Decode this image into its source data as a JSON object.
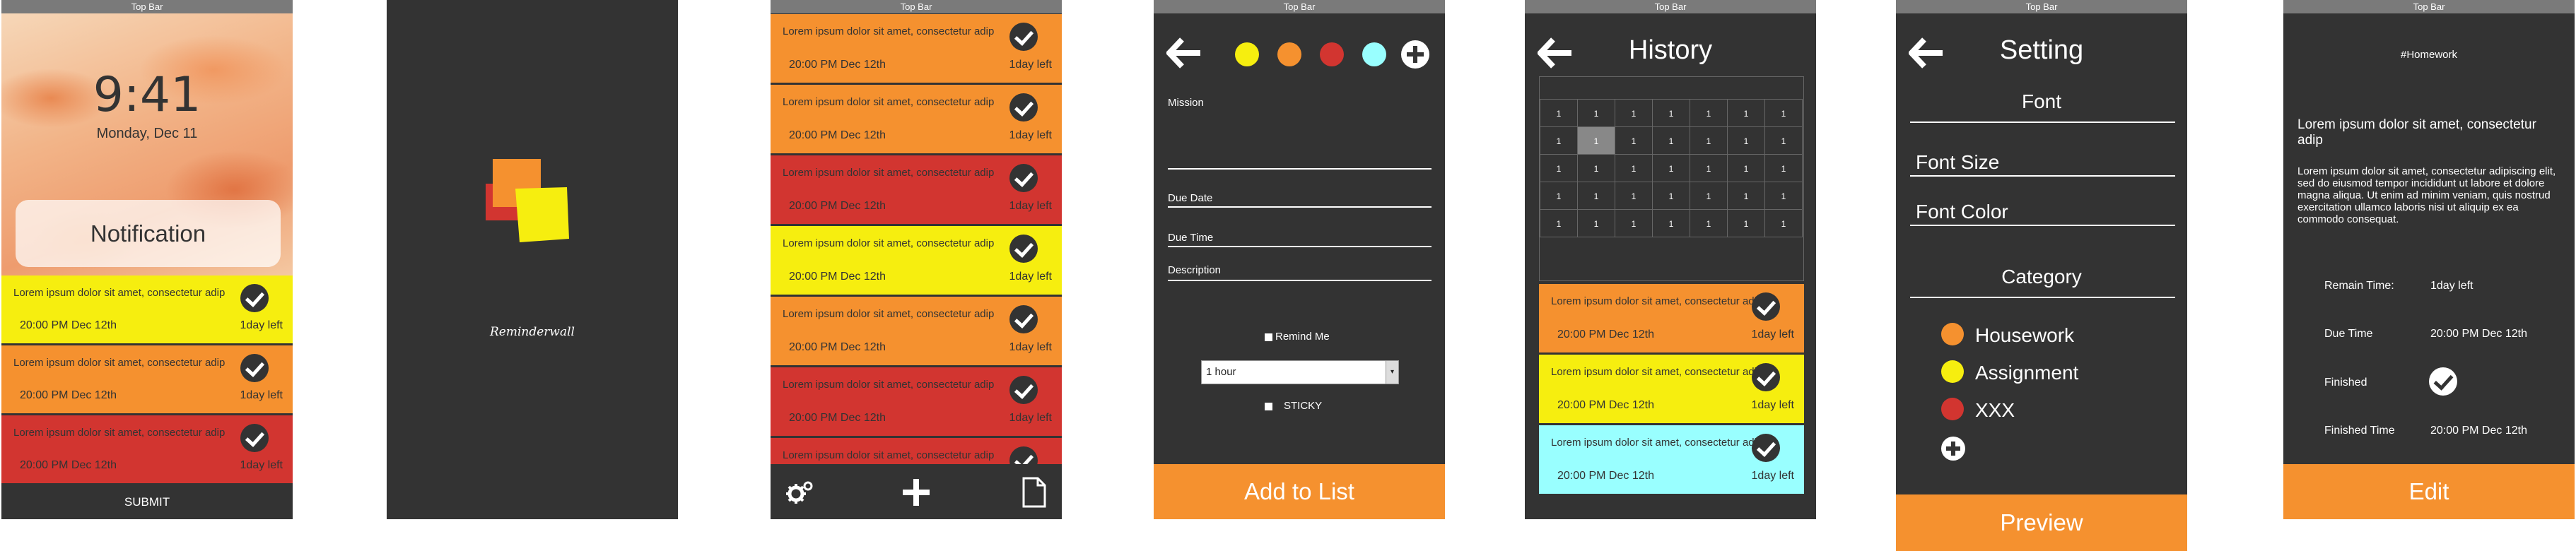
{
  "top_bar_label": "Top Bar",
  "colors": {
    "yellow": "#f6ee0f",
    "orange": "#f5912f",
    "red": "#d23530",
    "cyan": "#99ffff",
    "dark": "#333333"
  },
  "lock_screen": {
    "time": "9:41",
    "date": "Monday, Dec 11",
    "notification_label": "Notification",
    "cards": [
      {
        "text": "Lorem ipsum dolor sit amet, consectetur adip",
        "time": "20:00 PM Dec 12th",
        "left": "1day left",
        "color": "yellow"
      },
      {
        "text": "Lorem ipsum dolor sit amet, consectetur adip",
        "time": "20:00 PM Dec 12th",
        "left": "1day left",
        "color": "orange"
      },
      {
        "text": "Lorem ipsum dolor sit amet, consectetur adip",
        "time": "20:00 PM Dec 12th",
        "left": "1day left",
        "color": "red"
      }
    ],
    "submit_label": "SUBMIT"
  },
  "splash": {
    "app_name": "Reminderwall"
  },
  "list_screen": {
    "cards": [
      {
        "text": "Lorem ipsum dolor sit amet, consectetur adip",
        "time": "20:00 PM Dec 12th",
        "left": "1day left",
        "color": "orange"
      },
      {
        "text": "Lorem ipsum dolor sit amet, consectetur adip",
        "time": "20:00 PM Dec 12th",
        "left": "1day left",
        "color": "orange"
      },
      {
        "text": "Lorem ipsum dolor sit amet, consectetur adip",
        "time": "20:00 PM Dec 12th",
        "left": "1day left",
        "color": "red"
      },
      {
        "text": "Lorem ipsum dolor sit amet, consectetur adip",
        "time": "20:00 PM Dec 12th",
        "left": "1day left",
        "color": "yellow"
      },
      {
        "text": "Lorem ipsum dolor sit amet, consectetur adip",
        "time": "20:00 PM Dec 12th",
        "left": "1day left",
        "color": "orange"
      },
      {
        "text": "Lorem ipsum dolor sit amet, consectetur adip",
        "time": "20:00 PM Dec 12th",
        "left": "1day left",
        "color": "red"
      },
      {
        "text": "Lorem ipsum dolor sit amet, consectetur adip",
        "time": "",
        "left": "",
        "color": "red"
      }
    ],
    "bottom_icons": [
      "gears-icon",
      "plus-icon",
      "document-icon"
    ]
  },
  "add_screen": {
    "color_options": [
      "yellow",
      "orange",
      "red",
      "cyan"
    ],
    "mission_label": "Mission",
    "due_date_label": "Due Date",
    "due_time_label": "Due Time",
    "description_label": "Description",
    "remind_me_label": "Remind Me",
    "remind_select_value": "1 hour",
    "sticky_label": "STICKY",
    "add_button_label": "Add to List"
  },
  "history_screen": {
    "title": "History",
    "calendar_rows": [
      [
        "1",
        "1",
        "1",
        "1",
        "1",
        "1",
        "1"
      ],
      [
        "1",
        "1",
        "1",
        "1",
        "1",
        "1",
        "1"
      ],
      [
        "1",
        "1",
        "1",
        "1",
        "1",
        "1",
        "1"
      ],
      [
        "1",
        "1",
        "1",
        "1",
        "1",
        "1",
        "1"
      ],
      [
        "1",
        "1",
        "1",
        "1",
        "1",
        "1",
        "1"
      ]
    ],
    "cards": [
      {
        "text": "Lorem ipsum dolor sit amet, consectetur adip",
        "time": "20:00 PM Dec 12th",
        "left": "1day left",
        "color": "orange"
      },
      {
        "text": "Lorem ipsum dolor sit amet, consectetur adip",
        "time": "20:00 PM Dec 12th",
        "left": "1day left",
        "color": "yellow"
      },
      {
        "text": "Lorem ipsum dolor sit amet, consectetur adip",
        "time": "20:00 PM Dec 12th",
        "left": "1day left",
        "color": "cyan"
      }
    ]
  },
  "settings_screen": {
    "title": "Setting",
    "font_header": "Font",
    "font_size_label": "Font Size",
    "font_color_label": "Font Color",
    "category_header": "Category",
    "categories": [
      {
        "name": "Housework",
        "color": "orange"
      },
      {
        "name": "Assignment",
        "color": "yellow"
      },
      {
        "name": "XXX",
        "color": "red"
      }
    ],
    "preview_label": "Preview"
  },
  "detail_screen": {
    "tag": "#Homework",
    "heading": "Lorem ipsum dolor sit amet, consectetur adip",
    "body": "Lorem ipsum dolor sit amet, consectetur adipiscing elit, sed do eiusmod tempor incididunt ut labore et dolore magna aliqua. Ut enim ad minim veniam, quis nostrud exercitation ullamco laboris nisi ut aliquip ex ea commodo consequat.",
    "remain_time_label": "Remain Time:",
    "remain_time_value": "1day left",
    "due_time_label": "Due Time",
    "due_time_value": "20:00 PM Dec 12th",
    "finished_label": "Finished",
    "finished_time_label": "Finished Time",
    "finished_time_value": "20:00 PM Dec 12th",
    "edit_label": "Edit"
  }
}
